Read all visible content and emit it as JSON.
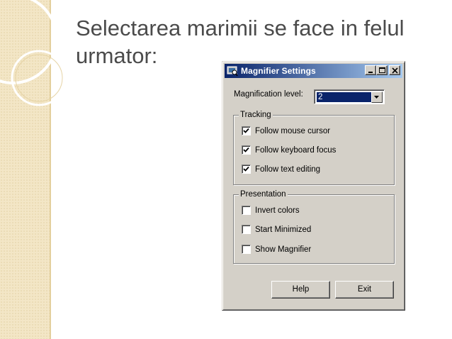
{
  "slide": {
    "title": "Selectarea marimii se face in felul urmator:"
  },
  "colors": {
    "title_text": "#4b4b4b",
    "side_band": "#f3e6c6",
    "titlebar_start": "#0a246a",
    "titlebar_end": "#a6caf0",
    "dialog_face": "#d4d0c8",
    "selection": "#0a246a"
  },
  "window": {
    "title": "Magnifier Settings",
    "icon": "magnifier-app-icon",
    "controls": {
      "minimize_icon": "minimize-icon",
      "maximize_icon": "maximize-icon",
      "close_icon": "close-icon"
    },
    "magnification": {
      "label": "Magnification level:",
      "value": "2"
    },
    "tracking": {
      "legend": "Tracking",
      "items": [
        {
          "label": "Follow mouse cursor",
          "checked": true
        },
        {
          "label": "Follow keyboard focus",
          "checked": true
        },
        {
          "label": "Follow text editing",
          "checked": true
        }
      ]
    },
    "presentation": {
      "legend": "Presentation",
      "items": [
        {
          "label": "Invert colors",
          "checked": false
        },
        {
          "label": "Start Minimized",
          "checked": false
        },
        {
          "label": "Show Magnifier",
          "checked": false
        }
      ]
    },
    "buttons": {
      "help": "Help",
      "exit": "Exit"
    }
  }
}
